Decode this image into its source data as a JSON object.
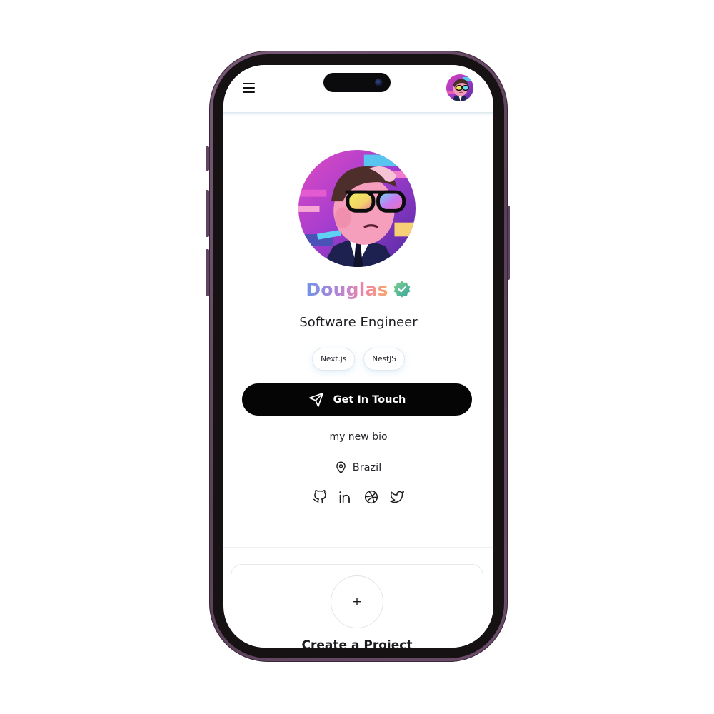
{
  "profile": {
    "name": "Douglas",
    "title": "Software Engineer",
    "bio": "my new bio",
    "location": "Brazil",
    "verified": true,
    "tags": [
      "Next.js",
      "NestJS"
    ]
  },
  "cta": {
    "label": "Get In Touch",
    "icon": "send-icon"
  },
  "socials": [
    {
      "icon": "github-icon"
    },
    {
      "icon": "linkedin-icon"
    },
    {
      "icon": "dribbble-icon"
    },
    {
      "icon": "twitter-icon"
    }
  ],
  "project_card": {
    "plus": "+",
    "title": "Create a Project"
  },
  "colors": {
    "accent_dark": "#050505",
    "name_gradient": [
      "#6f93ea",
      "#b384d8",
      "#ee84a8",
      "#f7a86a"
    ],
    "verified_badge": "#4cae8e",
    "phone_frame": "#6b4c69"
  }
}
